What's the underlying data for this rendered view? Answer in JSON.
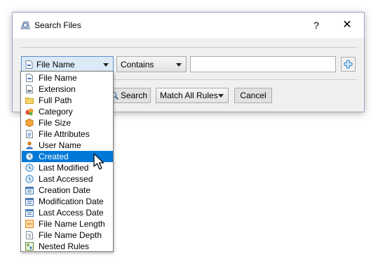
{
  "window": {
    "title": "Search Files",
    "help_glyph": "?",
    "close_glyph": "✕"
  },
  "rule": {
    "field_selected": "File Name",
    "operator": "Contains",
    "value": ""
  },
  "buttons": {
    "search": "Search",
    "match": "Match All Rules",
    "cancel": "Cancel"
  },
  "dropdown": {
    "items": [
      {
        "label": "File Name",
        "icon": "file-name-icon"
      },
      {
        "label": "Extension",
        "icon": "extension-icon"
      },
      {
        "label": "Full Path",
        "icon": "folder-icon"
      },
      {
        "label": "Category",
        "icon": "category-icon"
      },
      {
        "label": "File Size",
        "icon": "file-size-icon"
      },
      {
        "label": "File Attributes",
        "icon": "file-attributes-icon"
      },
      {
        "label": "User Name",
        "icon": "user-icon"
      },
      {
        "label": "Created",
        "icon": "clock-icon"
      },
      {
        "label": "Last Modified",
        "icon": "clock-icon"
      },
      {
        "label": "Last Accessed",
        "icon": "clock-icon"
      },
      {
        "label": "Creation Date",
        "icon": "calendar-icon"
      },
      {
        "label": "Modification Date",
        "icon": "calendar-icon"
      },
      {
        "label": "Last Access Date",
        "icon": "calendar-icon"
      },
      {
        "label": "File Name Length",
        "icon": "name-length-icon"
      },
      {
        "label": "File Name Depth",
        "icon": "name-depth-icon"
      },
      {
        "label": "Nested Rules",
        "icon": "nested-rules-icon"
      }
    ],
    "highlighted": "Created"
  },
  "colors": {
    "selection": "#0078d7",
    "dialog_bg": "#f0f0f0"
  }
}
